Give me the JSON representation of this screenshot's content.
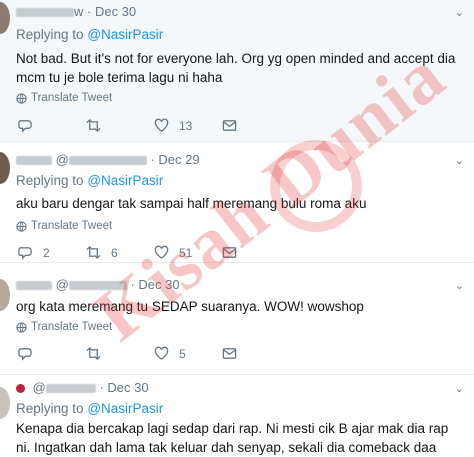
{
  "tweets": [
    {
      "handle_suffix": "w",
      "date": "Dec 30",
      "replying_prefix": "Replying to",
      "replying_handle": "@NasirPasir",
      "text": "Not bad. But it's not for everyone lah. Org yg open minded and accept dia mcm tu je bole terima lagu ni haha",
      "translate": "Translate Tweet",
      "replies": "",
      "retweets": "",
      "likes": "13"
    },
    {
      "handle_prefix": "@",
      "handle_suffix": "",
      "date": "Dec 29",
      "replying_prefix": "Replying to",
      "replying_handle": "@NasirPasir",
      "text": "aku baru dengar tak sampai half meremang bulu roma aku",
      "translate": "Translate Tweet",
      "replies": "2",
      "retweets": "6",
      "likes": "51"
    },
    {
      "handle_prefix": "@",
      "handle_suffix": "",
      "date": "Dec 30",
      "text": "org kata meremang tu SEDAP suaranya. WOW! wowshop",
      "translate": "Translate Tweet",
      "replies": "",
      "retweets": "",
      "likes": "5"
    },
    {
      "handle_prefix": "@",
      "date": "Dec 30",
      "replying_prefix": "Replying to",
      "replying_handle": "@NasirPasir",
      "text": "Kenapa dia bercakap lagi sedap dari rap. Ni mesti cik B ajar mak dia rap ni. Ingatkan dah lama tak keluar dah senyap, sekali dia comeback daa"
    }
  ],
  "watermark": "Kisah Dunia",
  "icons": {
    "reply": "reply-icon",
    "retweet": "retweet-icon",
    "like": "heart-icon",
    "dm": "envelope-icon",
    "translate": "globe-icon",
    "more": "chevron-down-icon"
  },
  "colors": {
    "link": "#1b95e0",
    "meta": "#657786",
    "highlight_bg": "#f5f8fa",
    "watermark": "#e22828"
  }
}
